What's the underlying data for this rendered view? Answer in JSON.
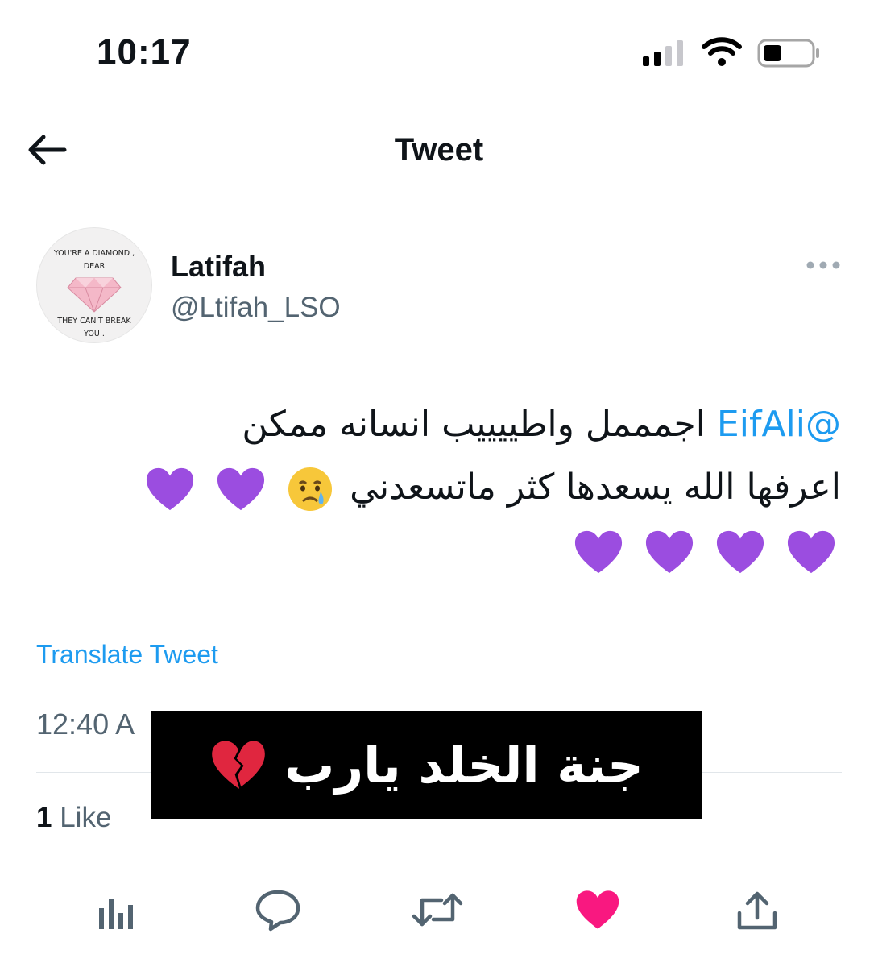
{
  "status_bar": {
    "time": "10:17"
  },
  "nav": {
    "title": "Tweet"
  },
  "author": {
    "name": "Latifah",
    "handle": "@Ltifah_LSO",
    "avatar_text": [
      "YOU'RE A DIAMOND ,",
      "DEAR",
      "THEY CAN'T BREAK",
      "YOU ."
    ]
  },
  "tweet": {
    "mention": "@EifAli",
    "line1": "اجمممل واطييييب انسانه ممكن",
    "line2": "اعرفها الله يسعدها كثر ماتسعدني",
    "emojis": [
      "crying-face",
      "purple-heart"
    ]
  },
  "translate_label": "Translate Tweet",
  "timestamp": "12:40 A",
  "likes": {
    "count": "1",
    "label": "Like"
  },
  "overlay": {
    "text": "جنة الخلد يارب",
    "emoji": "broken-heart"
  },
  "actions": [
    "analytics",
    "reply",
    "retweet",
    "like",
    "share"
  ],
  "colors": {
    "accent": "#1d9bf0",
    "like": "#f91880",
    "purple_heart": "#9b4de0"
  }
}
